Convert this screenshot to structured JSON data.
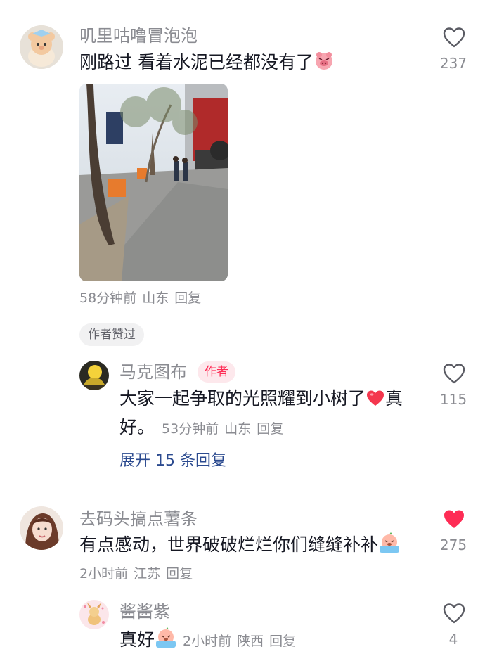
{
  "comments": [
    {
      "username": "叽里咕噜冒泡泡",
      "text": "刚路过 看着水泥已经都没有了",
      "emoji_icon": "pig-face-emoji-icon",
      "time": "58分钟前",
      "location": "山东",
      "reply_label": "回复",
      "likes": "237",
      "liked": false,
      "tag": "作者赞过",
      "replies": [
        {
          "username": "马克图布",
          "badge": "作者",
          "text_line1": "大家一起争取的光照耀到小树了",
          "emoji_icon": "red-heart-icon",
          "text_line1_end": "真",
          "text_line2": "好。",
          "time": "53分钟前",
          "location": "山东",
          "reply_label": "回复",
          "likes": "115",
          "liked": false
        }
      ],
      "expand_label": "展开 15 条回复"
    },
    {
      "username": "去码头搞点薯条",
      "text": "有点感动，世界破破烂烂你们缝缝补补",
      "emoji_icon": "crying-emoji-icon",
      "time": "2小时前",
      "location": "江苏",
      "reply_label": "回复",
      "likes": "275",
      "liked": true,
      "replies": [
        {
          "username": "酱酱紫",
          "text": "真好",
          "emoji_icon": "crying-emoji-icon",
          "time": "2小时前",
          "location": "陕西",
          "reply_label": "回复",
          "likes": "4",
          "liked": false
        }
      ]
    }
  ],
  "colors": {
    "liked": "#fe2c55",
    "meta": "#8a8b91",
    "link": "#2b4a8f"
  }
}
